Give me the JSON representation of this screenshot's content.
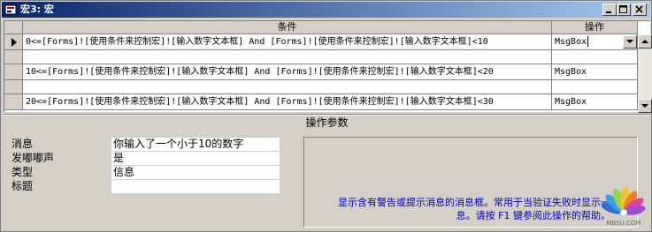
{
  "window": {
    "title": "宏3: 宏",
    "buttons": {
      "minimize": "minimize",
      "maximize": "maximize",
      "close": "close"
    }
  },
  "grid": {
    "columns": [
      "条件",
      "操作"
    ],
    "rows": [
      {
        "condition": "0<=[Forms]![使用条件来控制宏]![输入数字文本框] And [Forms]![使用条件来控制宏]![输入数字文本框]<10",
        "action": "MsgBox",
        "current": true
      },
      {
        "condition": "10<=[Forms]![使用条件来控制宏]![输入数字文本框] And [Forms]![使用条件来控制宏]![输入数字文本框]<20",
        "action": "MsgBox",
        "current": false
      },
      {
        "condition": "20<=[Forms]![使用条件来控制宏]![输入数字文本框] And [Forms]![使用条件来控制宏]![输入数字文本框]<30",
        "action": "MsgBox",
        "current": false
      }
    ]
  },
  "args": {
    "section_title": "操作参数",
    "items": [
      {
        "label": "消息",
        "value": "你输入了一个小于10的数字"
      },
      {
        "label": "发嘟嘟声",
        "value": "是"
      },
      {
        "label": "类型",
        "value": "信息"
      },
      {
        "label": "标题",
        "value": ""
      }
    ]
  },
  "help": {
    "text_line1": "显示含有警告或提示消息的消息框。常用于当验证失败时显示一",
    "text_line2": "息。请按 F1 键参阅此操作的帮助。"
  },
  "watermark": {
    "text": "MBSU.COM"
  },
  "colors": {
    "titlebar_start": "#0a246a",
    "titlebar_end": "#a6caf0",
    "help_text": "#0000c0"
  }
}
